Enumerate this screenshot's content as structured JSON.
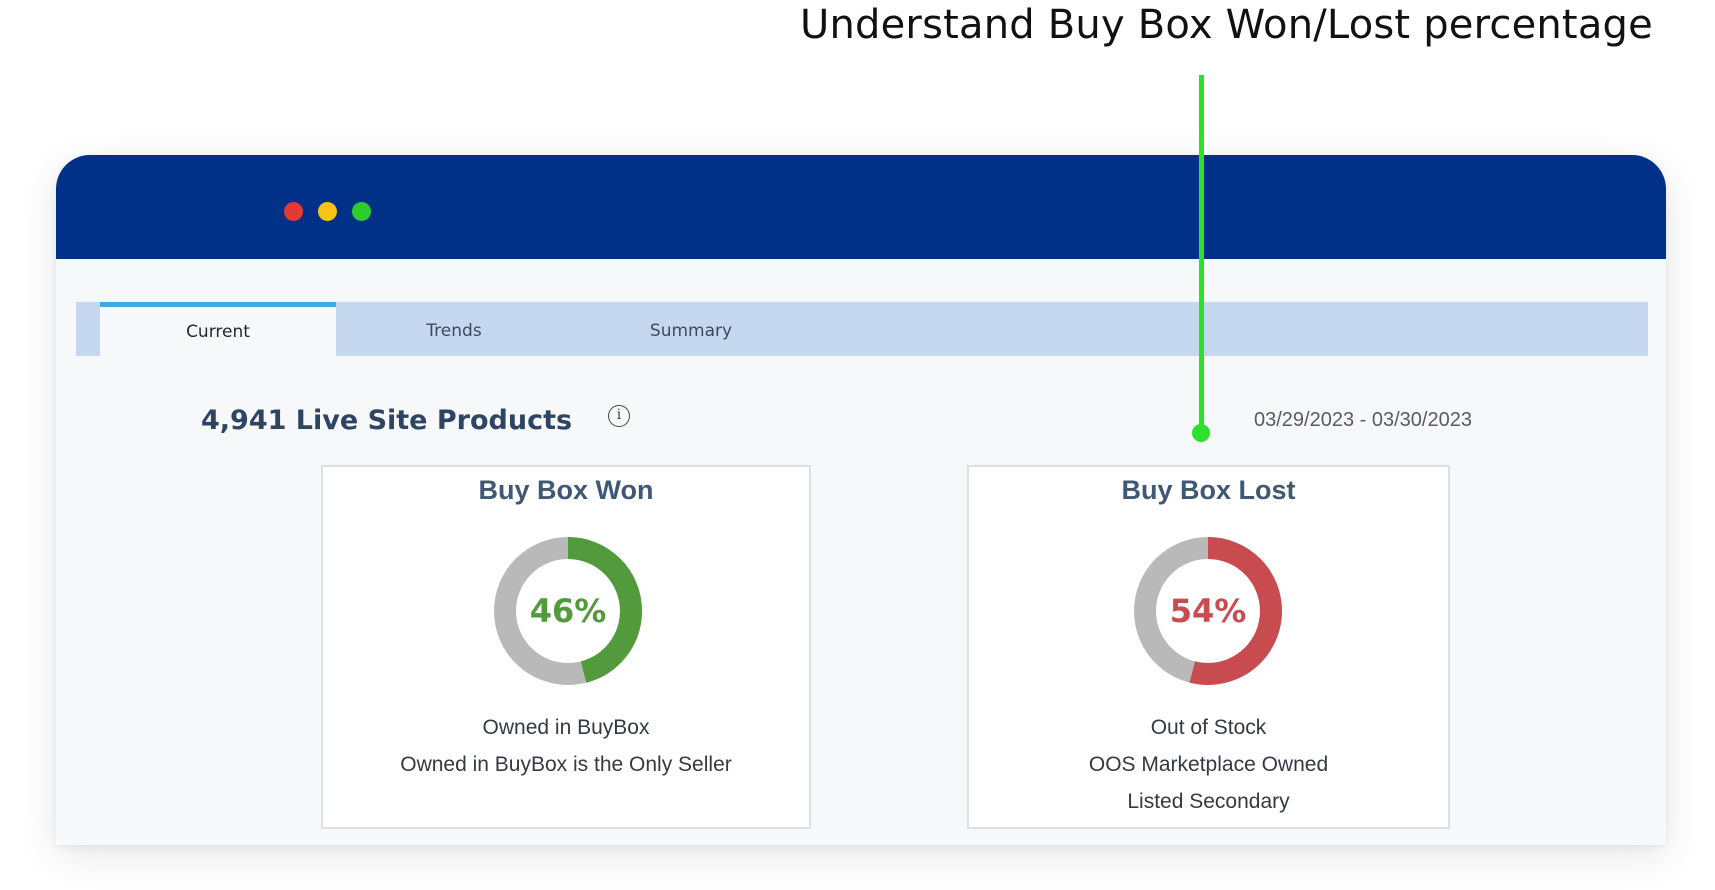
{
  "annotation": {
    "headline": "Understand Buy Box Won/Lost percentage",
    "pointer_color": "#2ee02e"
  },
  "window": {
    "titlebar_color": "#003087",
    "controls": [
      "close",
      "minimize",
      "maximize"
    ]
  },
  "tabs": [
    {
      "label": "Current",
      "active": true
    },
    {
      "label": "Trends",
      "active": false
    },
    {
      "label": "Summary",
      "active": false
    }
  ],
  "summary": {
    "products_label": "4,941 Live Site Products",
    "date_range": "03/29/2023 - 03/30/2023",
    "info_icon": "info-icon"
  },
  "cards": {
    "won": {
      "title": "Buy Box Won",
      "percent_label": "46%",
      "percent": 46,
      "color": "#529a3c",
      "lines": [
        "Owned in BuyBox",
        "Owned in BuyBox is the Only Seller"
      ]
    },
    "lost": {
      "title": "Buy Box Lost",
      "percent_label": "54%",
      "percent": 54,
      "color": "#c84c4f",
      "lines": [
        "Out of Stock",
        "OOS Marketplace Owned",
        "Listed Secondary"
      ]
    }
  }
}
